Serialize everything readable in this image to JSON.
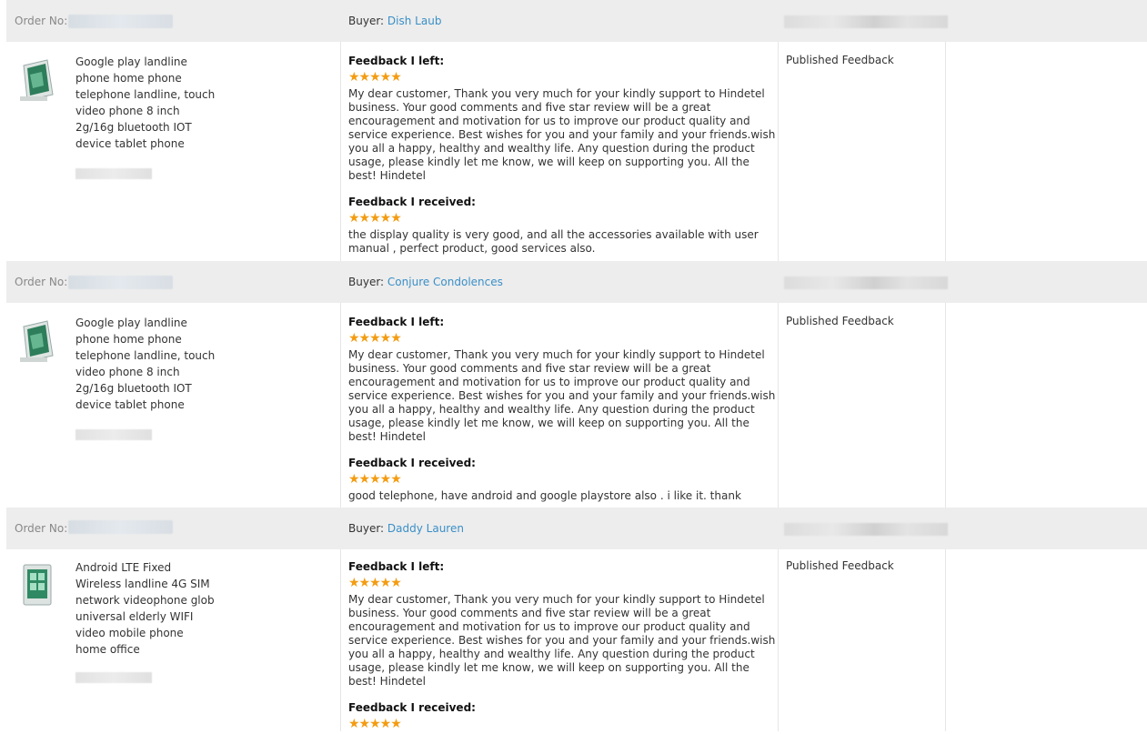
{
  "order_label": "Order No:",
  "buyer_label": "Buyer:",
  "feedback_left_label": "Feedback I left:",
  "feedback_received_label": "Feedback I received:",
  "stars": "★★★★★",
  "orders": [
    {
      "buyer": "Dish Laub",
      "product_title": "Google play landline phone home phone telephone landline, touch video phone 8 inch 2g/16g bluetooth IOT device tablet phone",
      "left_message": "My dear customer, Thank you very much for your kindly support to Hindetel business. Your good comments and five star review will be a great encouragement and motivation for us to improve our product quality and service experience. Best wishes for you and your family and your friends.wish you all a happy, healthy and wealthy life. Any question during the product usage, please kindly let me know, we will keep on supporting you. All the best! Hindetel",
      "received_message": "the display quality is very good, and all the accessories available with user manual , perfect product, good services also.",
      "status": "Published Feedback"
    },
    {
      "buyer": "Conjure Condolences",
      "product_title": "Google play landline phone home phone telephone landline, touch video phone 8 inch 2g/16g bluetooth IOT device tablet phone",
      "left_message": "My dear customer, Thank you very much for your kindly support to Hindetel business. Your good comments and five star review will be a great encouragement and motivation for us to improve our product quality and service experience. Best wishes for you and your family and your friends.wish you all a happy, healthy and wealthy life. Any question during the product usage, please kindly let me know, we will keep on supporting you. All the best! Hindetel",
      "received_message": "good telephone, have android and google playstore also . i like it. thank",
      "status": "Published Feedback"
    },
    {
      "buyer": "Daddy Lauren",
      "product_title": "Android LTE Fixed Wireless landline 4G SIM network videophone glob universal elderly WIFI video mobile phone home office",
      "left_message": "My dear customer, Thank you very much for your kindly support to Hindetel business. Your good comments and five star review will be a great encouragement and motivation for us to improve our product quality and service experience. Best wishes for you and your family and your friends.wish you all a happy, healthy and wealthy life. Any question during the product usage, please kindly let me know, we will keep on supporting you. All the best! Hindetel",
      "received_message": "",
      "status": "Published Feedback"
    }
  ],
  "colors": {
    "header_bg": "#ededed",
    "link": "#3a8fc7",
    "star": "#f39c12"
  }
}
